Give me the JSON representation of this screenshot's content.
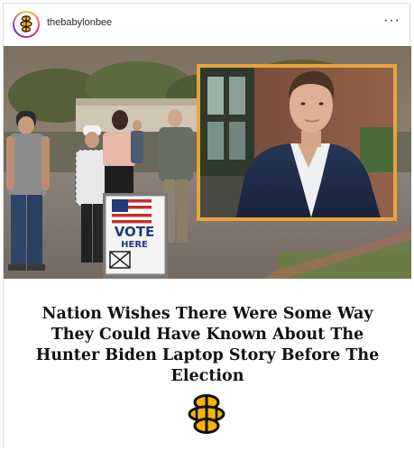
{
  "header": {
    "username": "thebabylonbee",
    "avatar_icon": "babylon-bee-logo-icon",
    "more_icon": "more-options-icon",
    "more_label": "···"
  },
  "photo": {
    "sign_line1": "VOTE",
    "sign_line2": "HERE",
    "inset_border_color": "#e8a43c"
  },
  "post": {
    "headline": "Nation Wishes There Were Some Way They Could Have Known About The Hunter Biden Laptop Story Before The Election",
    "footer_icon": "babylon-bee-logo-icon",
    "brand_color": "#f5b400"
  }
}
